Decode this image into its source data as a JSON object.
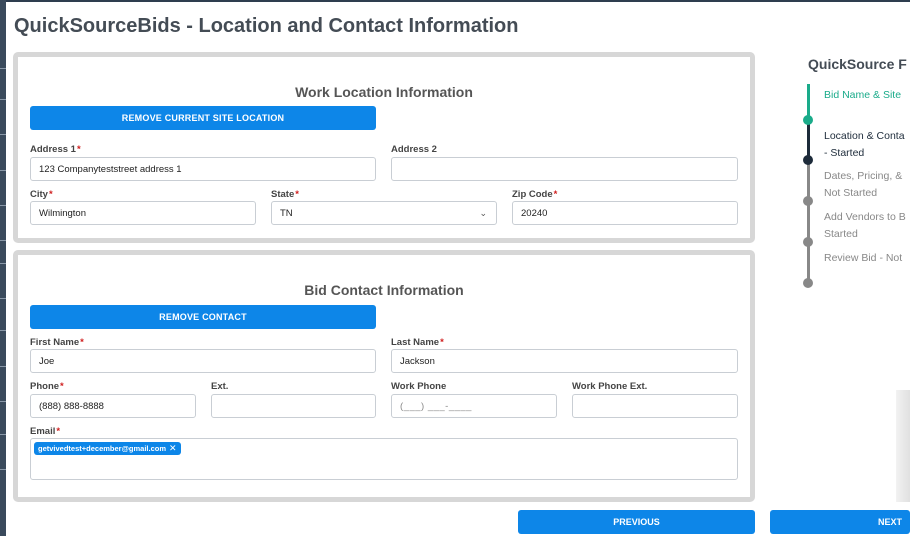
{
  "page_title": "QuickSourceBids - Location and Contact Information",
  "work_location": {
    "title": "Work Location Information",
    "remove_button": "REMOVE CURRENT SITE LOCATION",
    "address1": {
      "label": "Address 1",
      "value": "123 Companyteststreet address 1"
    },
    "address2": {
      "label": "Address 2",
      "value": ""
    },
    "city": {
      "label": "City",
      "value": "Wilmington"
    },
    "state": {
      "label": "State",
      "value": "TN"
    },
    "zip": {
      "label": "Zip Code",
      "value": "20240"
    }
  },
  "bid_contact": {
    "title": "Bid Contact Information",
    "remove_button": "REMOVE CONTACT",
    "first_name": {
      "label": "First Name",
      "value": "Joe"
    },
    "last_name": {
      "label": "Last Name",
      "value": "Jackson"
    },
    "phone": {
      "label": "Phone",
      "value": "(888) 888-8888"
    },
    "ext": {
      "label": "Ext.",
      "value": ""
    },
    "work_phone": {
      "label": "Work Phone",
      "placeholder": "(___) ___-____"
    },
    "work_phone_ext": {
      "label": "Work Phone Ext.",
      "value": ""
    },
    "email": {
      "label": "Email",
      "chip": "getvivedtest+december@gmail.com"
    }
  },
  "progress": {
    "title": "QuickSource F",
    "steps": [
      {
        "line1": "Bid Name & Site",
        "line2": "",
        "state": "done"
      },
      {
        "line1": "Location & Conta",
        "line2": "- Started",
        "state": "current"
      },
      {
        "line1": "Dates, Pricing, &",
        "line2": "Not Started",
        "state": "todo"
      },
      {
        "line1": "Add Vendors to B",
        "line2": "Started",
        "state": "todo"
      },
      {
        "line1": "Review Bid - Not",
        "line2": "",
        "state": "todo"
      }
    ]
  },
  "nav": {
    "previous": "PREVIOUS",
    "next": "NEXT"
  },
  "colors": {
    "accent": "#0d86e8",
    "done": "#1aab8a",
    "current": "#1d2b3a",
    "todo": "#888888",
    "required": "#d02020"
  }
}
